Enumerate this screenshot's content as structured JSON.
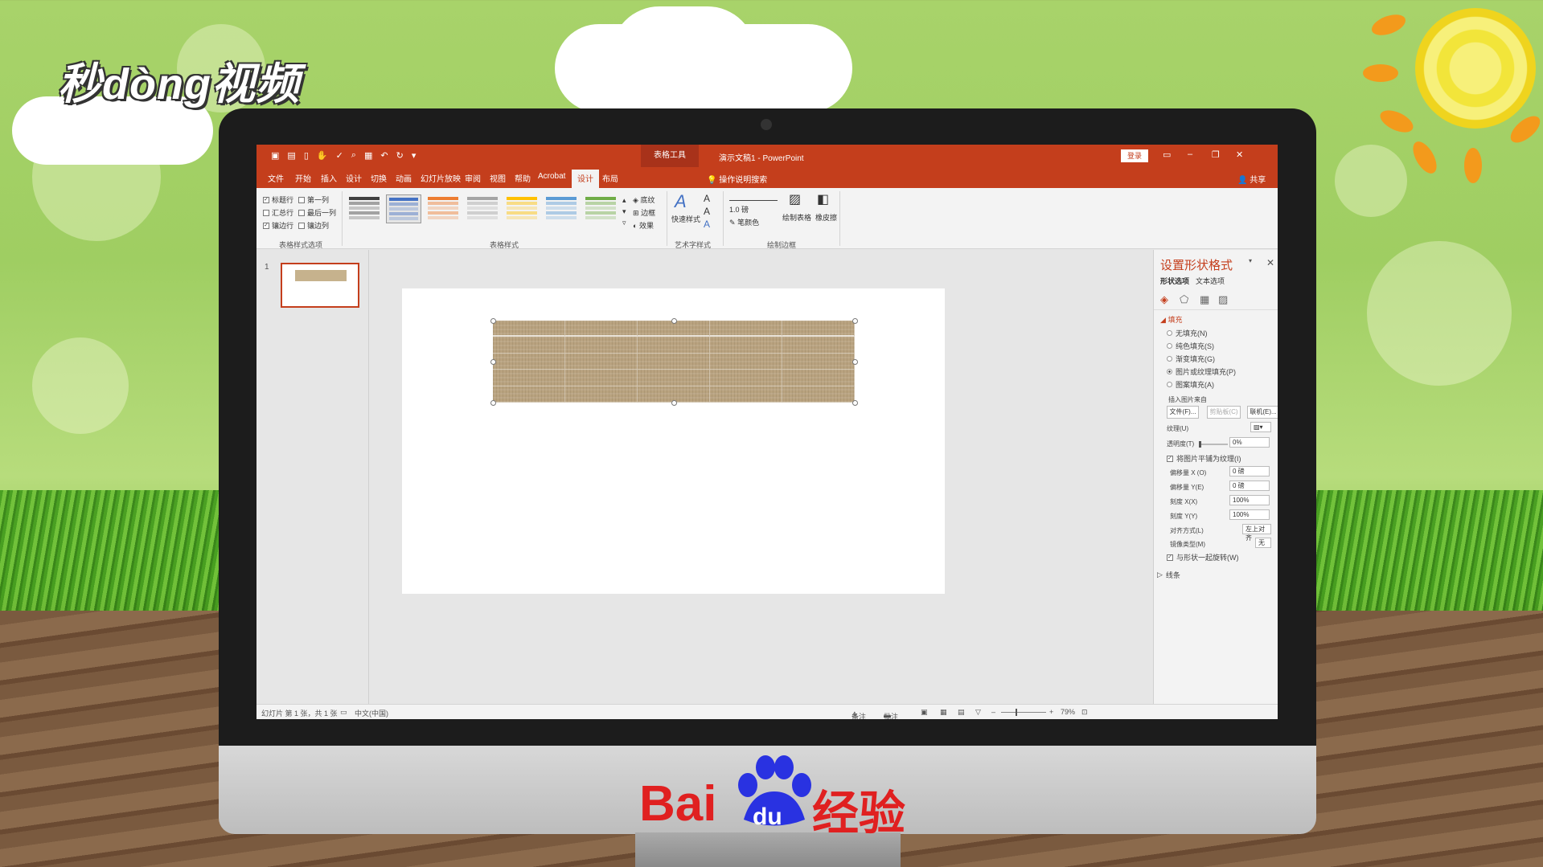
{
  "brand": {
    "top_logo": "秒dòng视频",
    "bottom_logo_text": "Bai",
    "bottom_logo_du": "du",
    "bottom_logo_suffix": "经验"
  },
  "window": {
    "title": "演示文稿1 - PowerPoint",
    "context_tab": "表格工具",
    "login_label": "登录",
    "share_label": "共享",
    "tell_me": "操作说明搜索"
  },
  "tabs": [
    {
      "label": "文件"
    },
    {
      "label": "开始"
    },
    {
      "label": "插入"
    },
    {
      "label": "设计"
    },
    {
      "label": "切换"
    },
    {
      "label": "动画"
    },
    {
      "label": "幻灯片放映"
    },
    {
      "label": "审阅"
    },
    {
      "label": "视图"
    },
    {
      "label": "帮助"
    },
    {
      "label": "Acrobat"
    },
    {
      "label": "设计",
      "active": true
    },
    {
      "label": "布局"
    }
  ],
  "ribbon": {
    "options": {
      "header_row": "标题行",
      "first_column": "第一列",
      "total_row": "汇总行",
      "last_column": "最后一列",
      "banded_rows": "镶边行",
      "banded_columns": "镶边列",
      "group_label": "表格样式选项"
    },
    "styles_group_label": "表格样式",
    "shading": "底纹",
    "borders": "边框",
    "effects": "效果",
    "quick_styles": "快速样式",
    "wordart_group_label": "艺术字样式",
    "pen_weight": "1.0 磅",
    "pen_color": "笔颜色",
    "draw_table": "绘制表格",
    "eraser": "橡皮擦",
    "draw_group_label": "绘制边框",
    "style_colors": [
      "#404040",
      "#4472c4",
      "#ed7d31",
      "#a5a5a5",
      "#ffc000",
      "#5b9bd5",
      "#70ad47"
    ]
  },
  "thumbnails": {
    "slide_number": "1"
  },
  "format_pane": {
    "title": "设置形状格式",
    "tab_shape": "形状选项",
    "tab_text": "文本选项",
    "fill_section": "填充",
    "fill_none": "无填充(N)",
    "fill_solid": "纯色填充(S)",
    "fill_gradient": "渐变填充(G)",
    "fill_picture": "图片或纹理填充(P)",
    "fill_pattern": "图案填充(A)",
    "insert_from": "插入图片来自",
    "btn_file": "文件(F)...",
    "btn_clipboard": "剪贴板(C)",
    "btn_online": "联机(E)...",
    "texture": "纹理(U)",
    "transparency": "透明度(T)",
    "transparency_value": "0%",
    "tile": "将图片平铺为纹理(I)",
    "offset_x": "偏移量 X (O)",
    "offset_x_value": "0 磅",
    "offset_y": "偏移量 Y(E)",
    "offset_y_value": "0 磅",
    "scale_x": "刻度 X(X)",
    "scale_x_value": "100%",
    "scale_y": "刻度 Y(Y)",
    "scale_y_value": "100%",
    "alignment": "对齐方式(L)",
    "alignment_value": "左上对齐",
    "mirror": "镜像类型(M)",
    "mirror_value": "无",
    "rotate_with_shape": "与形状一起旋转(W)",
    "line_section": "线条"
  },
  "status": {
    "slide_info": "幻灯片 第 1 张，共 1 张",
    "language": "中文(中国)",
    "notes": "备注",
    "comments": "批注",
    "zoom": "79%"
  }
}
